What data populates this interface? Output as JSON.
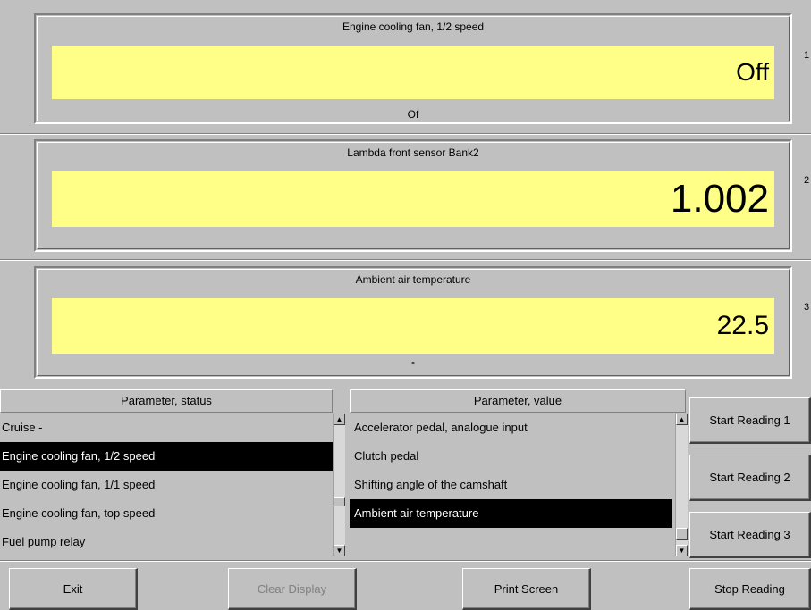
{
  "panels": [
    {
      "title": "Engine cooling fan, 1/2 speed",
      "value": "Off",
      "unit": "Of",
      "number": "1"
    },
    {
      "title": "Lambda front sensor Bank2",
      "value": "1.002",
      "unit": "",
      "number": "2"
    },
    {
      "title": "Ambient air temperature",
      "value": "22.5",
      "unit": "°",
      "number": "3"
    }
  ],
  "status_list": {
    "header": "Parameter, status",
    "items": [
      "Cruise -",
      "Engine cooling fan, 1/2 speed",
      "Engine cooling fan, 1/1 speed",
      "Engine cooling fan, top speed",
      "Fuel pump relay"
    ],
    "selected": "Engine cooling fan, 1/2 speed"
  },
  "value_list": {
    "header": "Parameter, value",
    "items": [
      "Accelerator pedal, analogue input",
      "Clutch pedal",
      "Shifting angle of the camshaft",
      "Ambient air temperature"
    ],
    "selected": "Ambient air temperature"
  },
  "side_buttons": {
    "start1": "Start Reading 1",
    "start2": "Start Reading 2",
    "start3": "Start Reading 3"
  },
  "bottom_buttons": {
    "exit": "Exit",
    "clear": "Clear Display",
    "print": "Print Screen",
    "stop": "Stop Reading"
  },
  "colors": {
    "display_bg": "#ffff88",
    "selection_bg": "#000000"
  }
}
